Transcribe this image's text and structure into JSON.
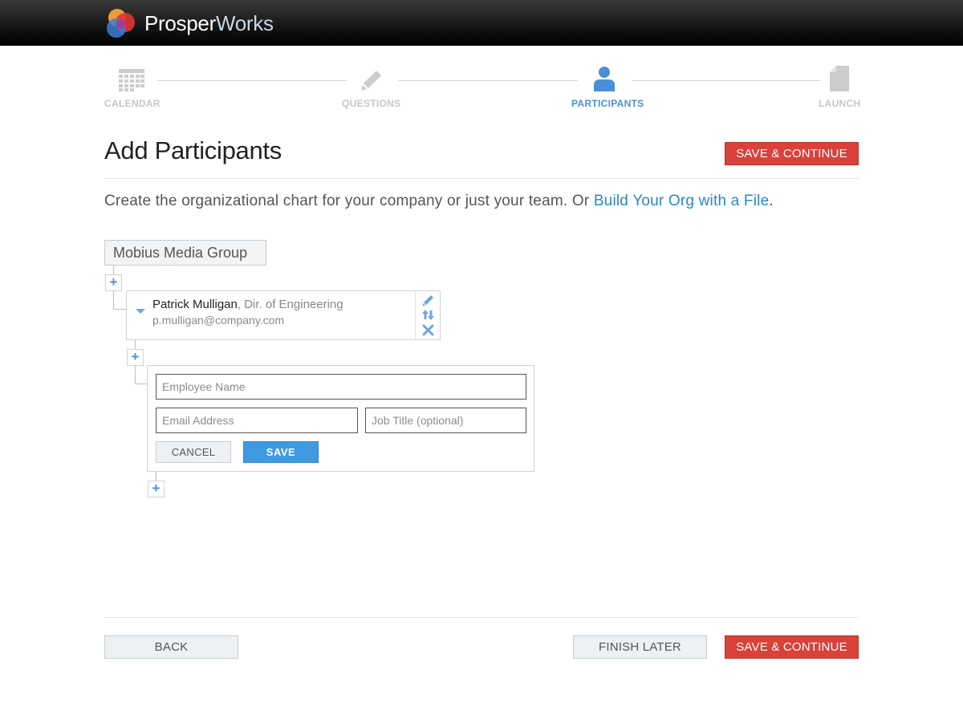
{
  "header": {
    "brand_part1": "Prosper",
    "brand_part2": "Works",
    "logo_icon": "prosperworks-logo-icon"
  },
  "stepper": {
    "steps": [
      {
        "label": "CALENDAR",
        "icon": "calendar-icon",
        "active": false
      },
      {
        "label": "QUESTIONS",
        "icon": "pencil-icon",
        "active": false
      },
      {
        "label": "PARTICIPANTS",
        "icon": "person-icon",
        "active": true
      },
      {
        "label": "LAUNCH",
        "icon": "document-icon",
        "active": false
      }
    ]
  },
  "page": {
    "title": "Add Participants",
    "save_continue_top": "SAVE & CONTINUE",
    "intro_text": "Create the organizational chart for your company or just your team.  Or ",
    "intro_link": "Build Your Org with a File",
    "intro_end": "."
  },
  "org": {
    "root_name": "Mobius Media Group",
    "person": {
      "name": "Patrick Mulligan",
      "title": ", Dir. of Engineering",
      "email": "p.mulligan@company.com"
    },
    "form": {
      "name_placeholder": "Employee Name",
      "email_placeholder": "Email Address",
      "job_placeholder": "Job Title (optional)",
      "cancel_label": "CANCEL",
      "save_label": "SAVE"
    },
    "plus_label": "+"
  },
  "footer": {
    "back_label": "BACK",
    "finish_later_label": "FINISH LATER",
    "save_continue_label": "SAVE & CONTINUE"
  },
  "colors": {
    "accent_red": "#d94139",
    "accent_blue": "#4a90d9",
    "link_blue": "#2a86c8"
  }
}
